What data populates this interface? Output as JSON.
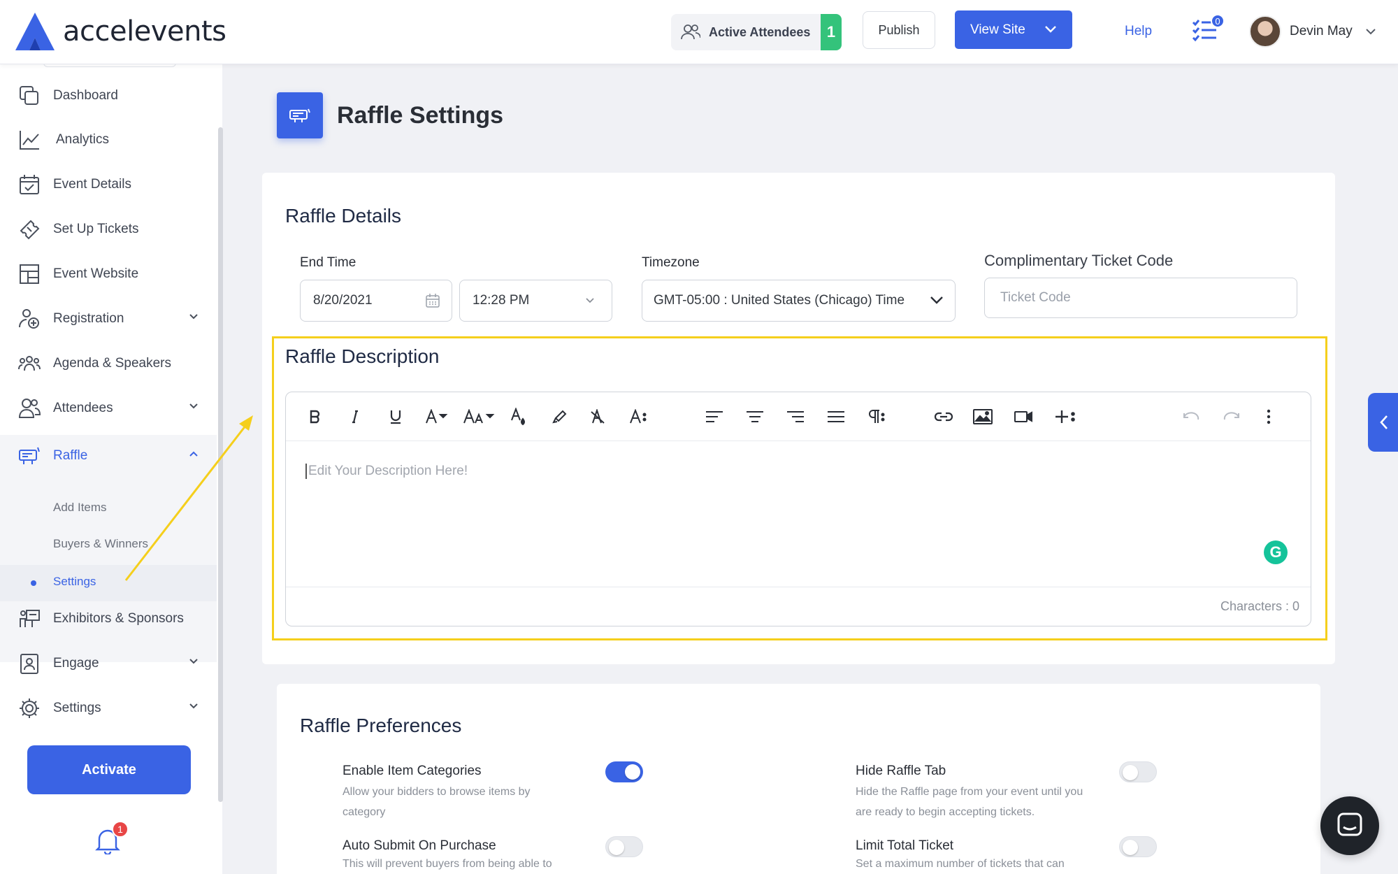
{
  "brand": {
    "name": "accelevents",
    "accent": "#3a63e4"
  },
  "header": {
    "active_attendees_label": "Active Attendees",
    "active_attendees_count": "1",
    "publish_label": "Publish",
    "view_site_label": "View Site",
    "help_label": "Help",
    "tasks_badge": "0",
    "user_name": "Devin May"
  },
  "sidebar": {
    "items": [
      {
        "label": "Dashboard",
        "icon": "dashboard-icon"
      },
      {
        "label": "Analytics",
        "icon": "analytics-icon"
      },
      {
        "label": "Event Details",
        "icon": "calendar-icon"
      },
      {
        "label": "Set Up Tickets",
        "icon": "ticket-icon"
      },
      {
        "label": "Event Website",
        "icon": "layout-icon"
      },
      {
        "label": "Registration",
        "icon": "registration-icon"
      },
      {
        "label": "Agenda & Speakers",
        "icon": "people-icon"
      },
      {
        "label": "Attendees",
        "icon": "attendees-icon"
      },
      {
        "label": "Raffle",
        "icon": "raffle-icon"
      },
      {
        "label": "Exhibitors & Sponsors",
        "icon": "exhibitor-icon"
      },
      {
        "label": "Engage",
        "icon": "engage-icon"
      },
      {
        "label": "Settings",
        "icon": "gear-icon"
      }
    ],
    "raffle_sub": [
      "Add Items",
      "Buyers & Winners",
      "Settings"
    ],
    "activate_label": "Activate",
    "notification_badge": "1"
  },
  "page": {
    "title": "Raffle Settings"
  },
  "raffle_details": {
    "title": "Raffle Details",
    "end_time_label": "End Time",
    "end_date": "8/20/2021",
    "end_clock": "12:28 PM",
    "timezone_label": "Timezone",
    "timezone_value": "GMT-05:00 : United States (Chicago) Time",
    "ticket_code_label": "Complimentary Ticket Code",
    "ticket_code_placeholder": "Ticket Code"
  },
  "description": {
    "title": "Raffle Description",
    "placeholder": "Edit Your Description Here!",
    "char_count": "Characters : 0"
  },
  "preferences": {
    "title": "Raffle Preferences",
    "items": [
      {
        "title": "Enable Item Categories",
        "desc": "Allow your bidders to browse items by category",
        "on": true
      },
      {
        "title": "Hide Raffle Tab",
        "desc": "Hide the Raffle page from your event until you are ready to begin accepting tickets.",
        "on": false
      },
      {
        "title": "Auto Submit On Purchase",
        "desc": "This will prevent buyers from being able to",
        "on": false
      },
      {
        "title": "Limit Total Ticket",
        "desc": "Set a maximum number of tickets that can",
        "on": false
      }
    ]
  }
}
